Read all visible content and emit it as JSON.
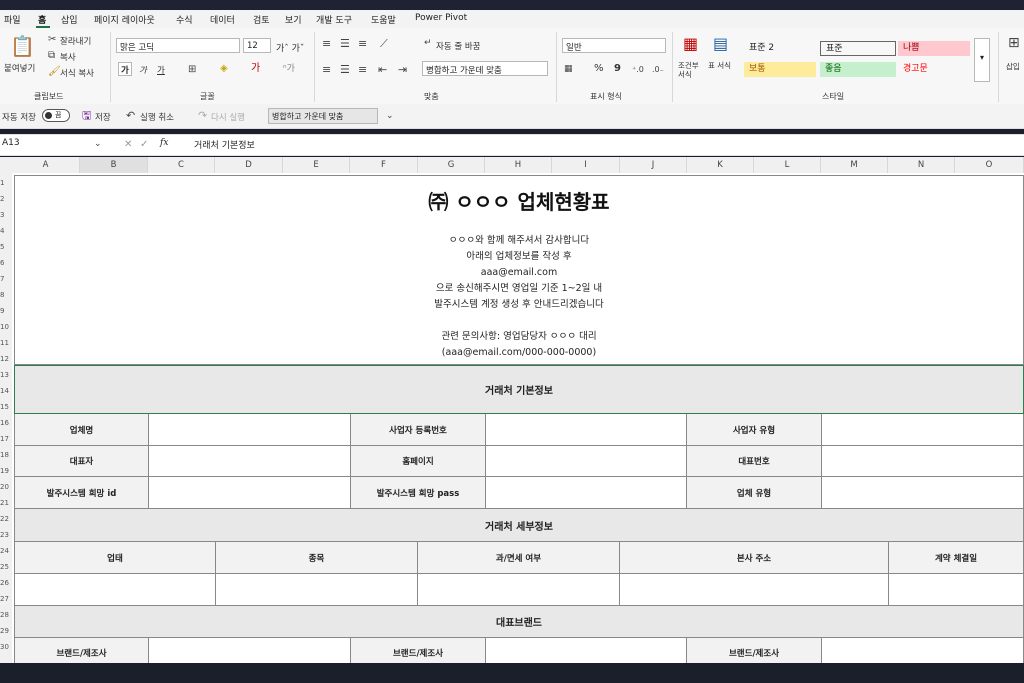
{
  "menu": {
    "items": [
      "파일",
      "홈",
      "삽입",
      "페이지 레이아웃",
      "수식",
      "데이터",
      "검토",
      "보기",
      "개발 도구",
      "도움말",
      "Power Pivot"
    ],
    "active": "홈"
  },
  "ribbon": {
    "paste_label": "붙여넣기",
    "cut_label": "잘라내기",
    "copy_label": "복사",
    "format_painter_label": "서식 복사",
    "clipboard_group": "클립보드",
    "font_name": "맑은 고딕",
    "font_size": "12",
    "font_group": "글꼴",
    "bold_label": "가",
    "italic_label": "가",
    "underline_label": "가",
    "wrap_text": "자동 줄 바꿈",
    "merge_center": "병합하고 가운데 맞춤",
    "align_group": "맞춤",
    "number_format": "일반",
    "number_group": "표시 형식",
    "percent": "%",
    "comma": "9",
    "cond_format": "조건부 서식",
    "table_format": "표 서식",
    "styles_group": "스타일",
    "styles": [
      {
        "label": "표준 2",
        "bg": "#ffffff",
        "color": "#222222"
      },
      {
        "label": "표준",
        "bg": "#ffffff",
        "color": "#222222"
      },
      {
        "label": "나쁨",
        "bg": "#ffc7ce",
        "color": "#9c0006"
      },
      {
        "label": "보통",
        "bg": "#ffeb9c",
        "color": "#9c5700"
      },
      {
        "label": "좋음",
        "bg": "#c6efce",
        "color": "#006100"
      },
      {
        "label": "경고문",
        "bg": "#ffffff",
        "color": "#ff0000"
      }
    ],
    "insert_label": "삽입"
  },
  "qat": {
    "autosave_label": "자동 저장",
    "autosave_state": "끔",
    "save_label": "저장",
    "undo_label": "실행 취소",
    "redo_label": "다시 실행",
    "merge_label": "병합하고 가운데 맞춤"
  },
  "formula_bar": {
    "name_box": "A13",
    "fx": "fx",
    "content": "거래처 기본정보"
  },
  "columns": [
    "A",
    "B",
    "C",
    "D",
    "E",
    "F",
    "G",
    "H",
    "I",
    "J",
    "K",
    "L",
    "M",
    "N",
    "O"
  ],
  "rows": [
    "1",
    "2",
    "3",
    "4",
    "5",
    "6",
    "7",
    "8",
    "9",
    "10",
    "11",
    "12",
    "13",
    "14",
    "15",
    "16",
    "17",
    "18",
    "19",
    "20",
    "21",
    "22",
    "23",
    "24",
    "25",
    "26",
    "27",
    "28",
    "29",
    "30"
  ],
  "sheet": {
    "title": "㈜ ㅇㅇㅇ 업체현황표",
    "intro_lines": [
      "ㅇㅇㅇ와 함께 해주셔서 감사합니다",
      "아래의 업체정보를 작성 후",
      "aaa@email.com",
      "으로 송신해주시면 영업일 기준 1~2일 내",
      "발주시스템 계정 생성 후 안내드리겠습니다",
      "",
      "관련 문의사항: 영업담당자 ㅇㅇㅇ 대리",
      "(aaa@email.com/000-000-0000)"
    ],
    "section_basic": "거래처 기본정보",
    "basic_labels": [
      [
        "업체명",
        "사업자 등록번호",
        "사업자 유형"
      ],
      [
        "대표자",
        "홈페이지",
        "대표번호"
      ],
      [
        "발주시스템 희망 id",
        "발주시스템 희망 pass",
        "업체 유형"
      ]
    ],
    "section_detail": "거래처 세부정보",
    "detail_headers": [
      "업태",
      "종목",
      "과/면세 여부",
      "본사 주소",
      "계약 체결일"
    ],
    "section_brand": "대표브랜드",
    "brand_labels": [
      "브랜드/제조사",
      "브랜드/제조사",
      "브랜드/제조사"
    ]
  }
}
